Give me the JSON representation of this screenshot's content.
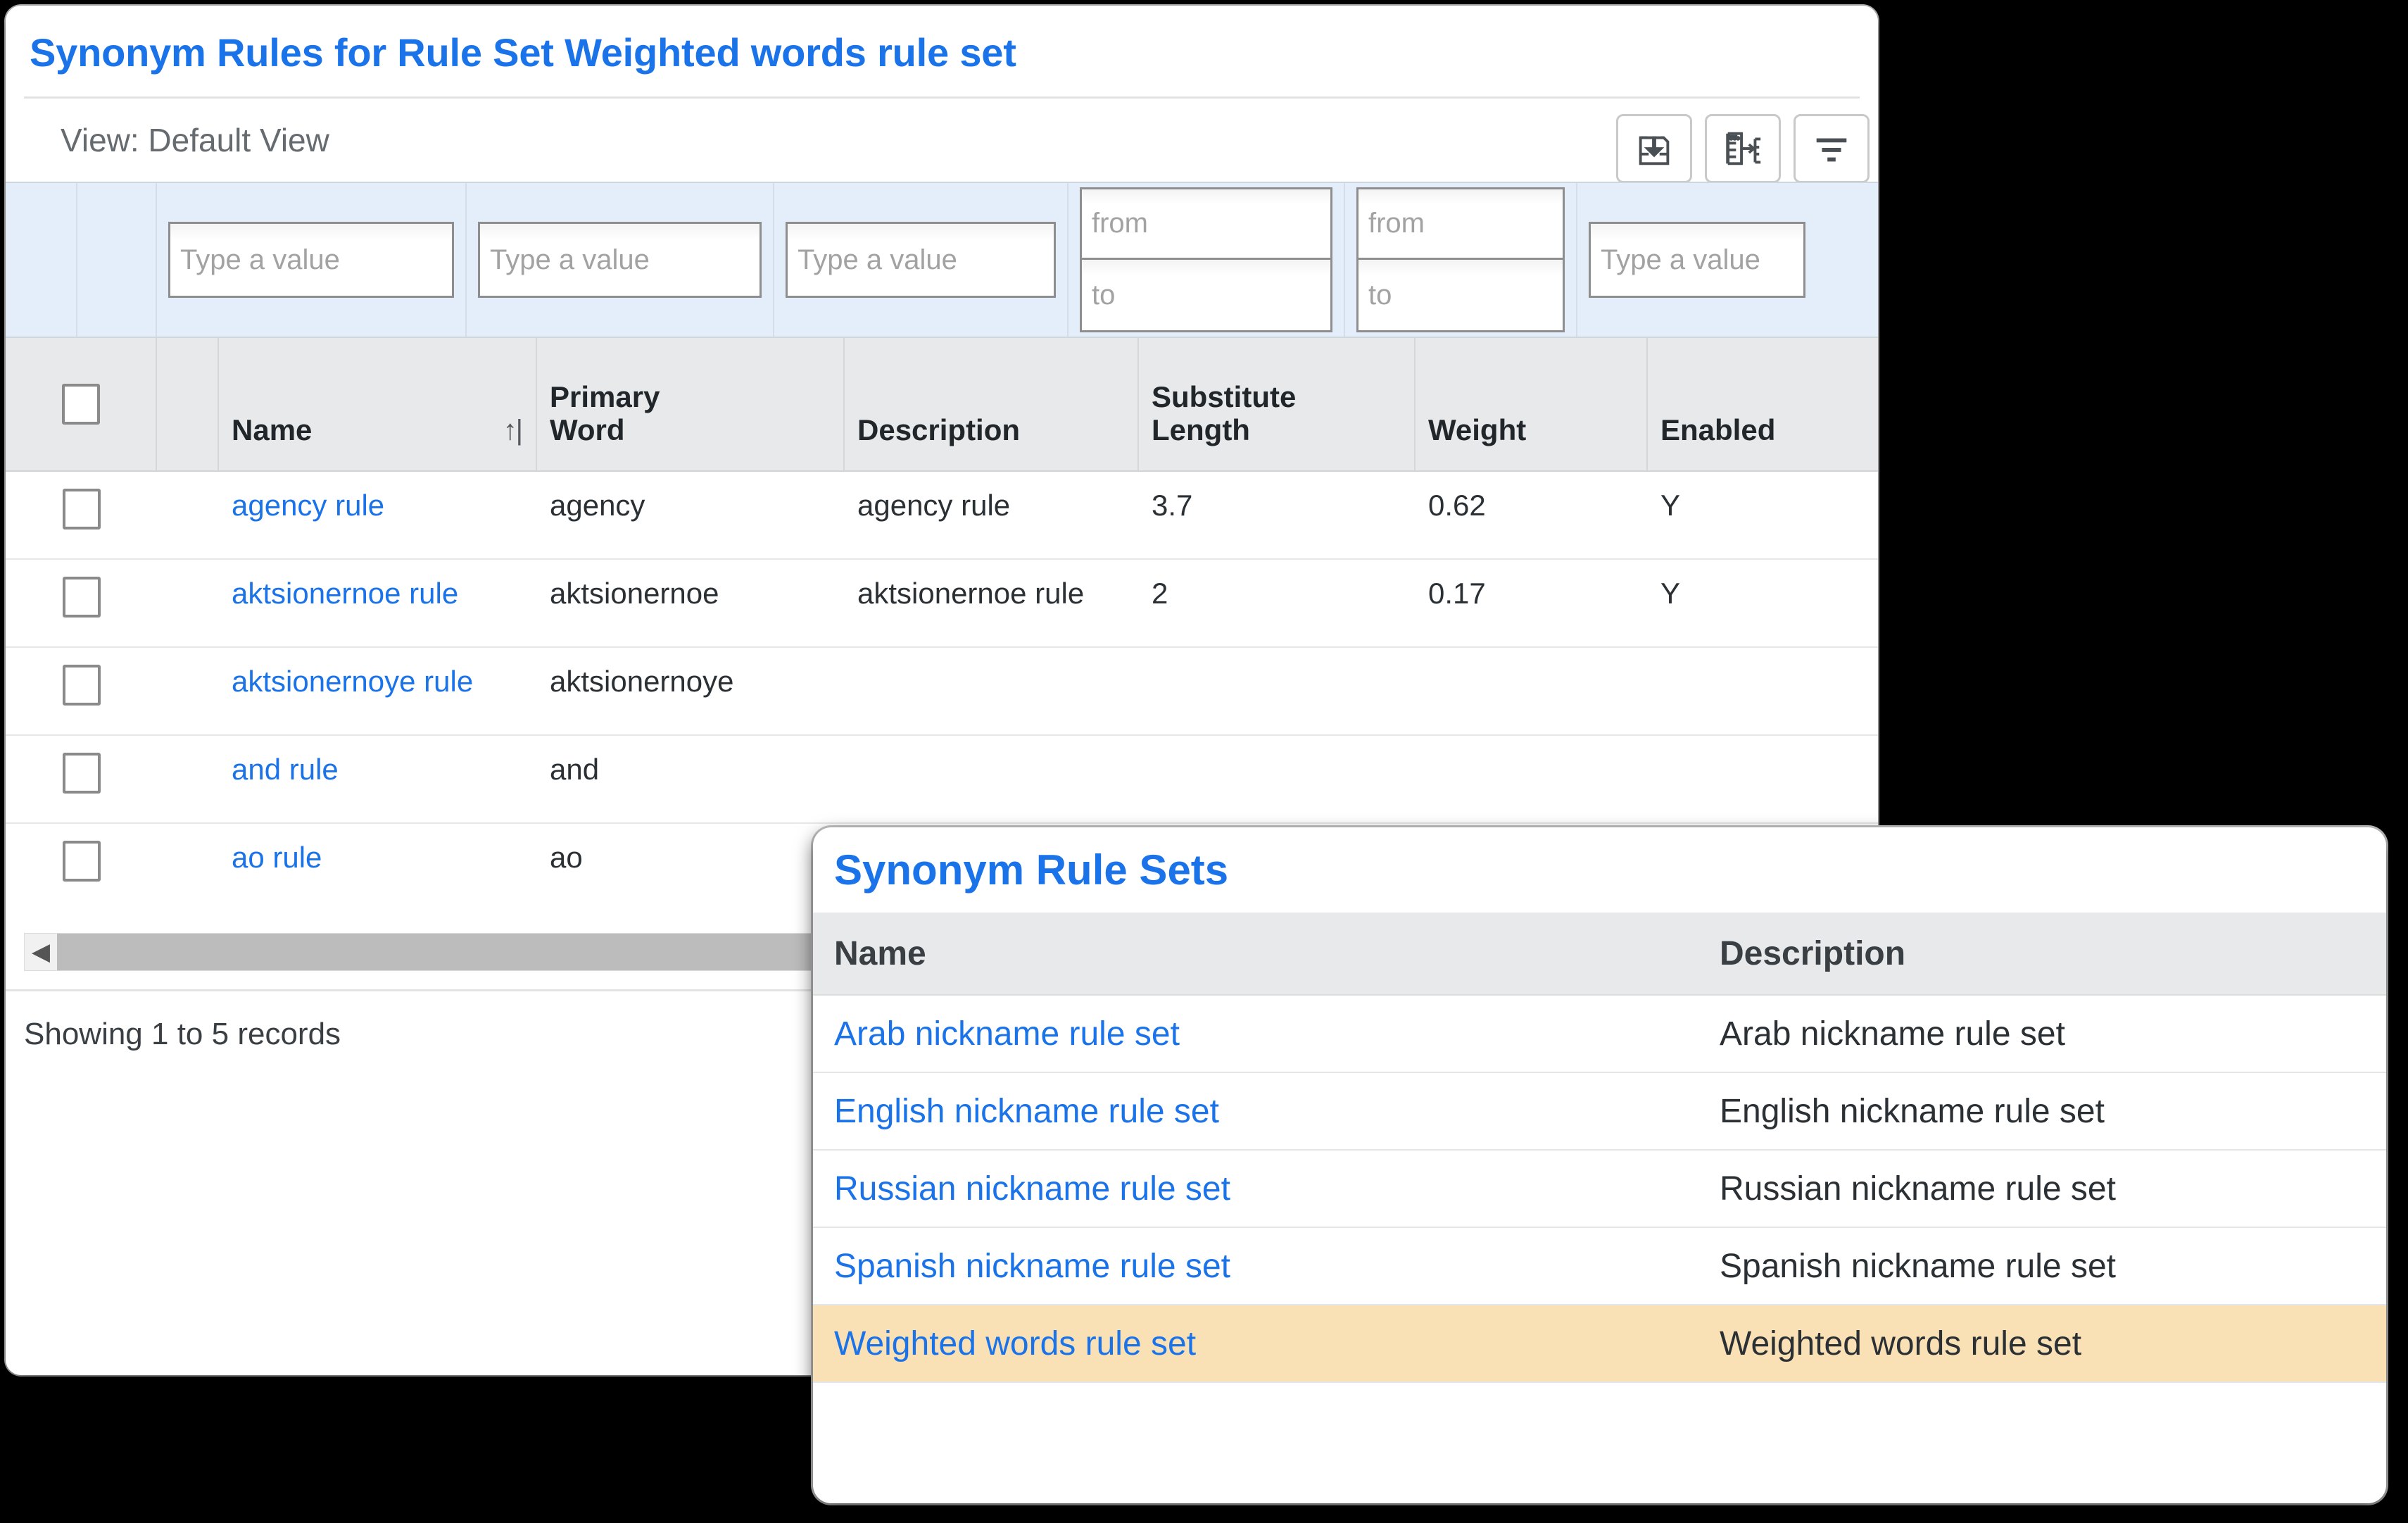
{
  "rules_panel": {
    "title": "Synonym Rules for Rule Set Weighted words rule set",
    "view_label": "View: Default View",
    "toolbar": [
      {
        "name": "import-icon",
        "tooltip": "Import"
      },
      {
        "name": "export-mapping-icon",
        "tooltip": "Export"
      },
      {
        "name": "filter-icon",
        "tooltip": "Filter"
      }
    ],
    "filters": [
      {
        "type": "text",
        "placeholder": "Type a value"
      },
      {
        "type": "text",
        "placeholder": "Type a value"
      },
      {
        "type": "text",
        "placeholder": "Type a value"
      },
      {
        "type": "range",
        "from_placeholder": "from",
        "to_placeholder": "to"
      },
      {
        "type": "range",
        "from_placeholder": "from",
        "to_placeholder": "to"
      },
      {
        "type": "text",
        "placeholder": "Type a value"
      }
    ],
    "columns": [
      {
        "label": "Name",
        "sort": "↑|"
      },
      {
        "label_line1": "Primary",
        "label_line2": "Word"
      },
      {
        "label": "Description"
      },
      {
        "label_line1": "Substitute",
        "label_line2": "Length"
      },
      {
        "label": "Weight"
      },
      {
        "label": "Enabled"
      }
    ],
    "rows": [
      {
        "name": "agency rule",
        "primary_word": "agency",
        "description": "agency rule",
        "substitute_length": "3.7",
        "weight": "0.62",
        "enabled": "Y"
      },
      {
        "name": "aktsionernoe rule",
        "primary_word": "aktsionernoe",
        "description": "aktsionernoe rule",
        "substitute_length": "2",
        "weight": "0.17",
        "enabled": "Y"
      },
      {
        "name": "aktsionernoye rule",
        "primary_word": "aktsionernoye",
        "description": "",
        "substitute_length": "",
        "weight": "",
        "enabled": ""
      },
      {
        "name": "and rule",
        "primary_word": "and",
        "description": "",
        "substitute_length": "",
        "weight": "",
        "enabled": ""
      },
      {
        "name": "ao rule",
        "primary_word": "ao",
        "description": "",
        "substitute_length": "",
        "weight": "",
        "enabled": ""
      }
    ],
    "records_text": "Showing 1 to 5 records",
    "scroll_arrow": "◀"
  },
  "sets_panel": {
    "title": "Synonym Rule Sets",
    "columns": {
      "name": "Name",
      "description": "Description"
    },
    "rows": [
      {
        "name": "Arab nickname rule set",
        "description": "Arab nickname rule set",
        "selected": false
      },
      {
        "name": "English nickname rule set",
        "description": "English nickname rule set",
        "selected": false
      },
      {
        "name": "Russian nickname rule set",
        "description": "Russian nickname rule set",
        "selected": false
      },
      {
        "name": "Spanish nickname rule set",
        "description": "Spanish nickname rule set",
        "selected": false
      },
      {
        "name": "Weighted words rule set",
        "description": "Weighted words rule set",
        "selected": true
      }
    ]
  },
  "colors": {
    "link_blue": "#1a73e8",
    "filter_bar_blue": "#e4eefa",
    "header_gray": "#e8e9ea",
    "selected_row": "#fae0b5",
    "page_background": "#000000"
  }
}
